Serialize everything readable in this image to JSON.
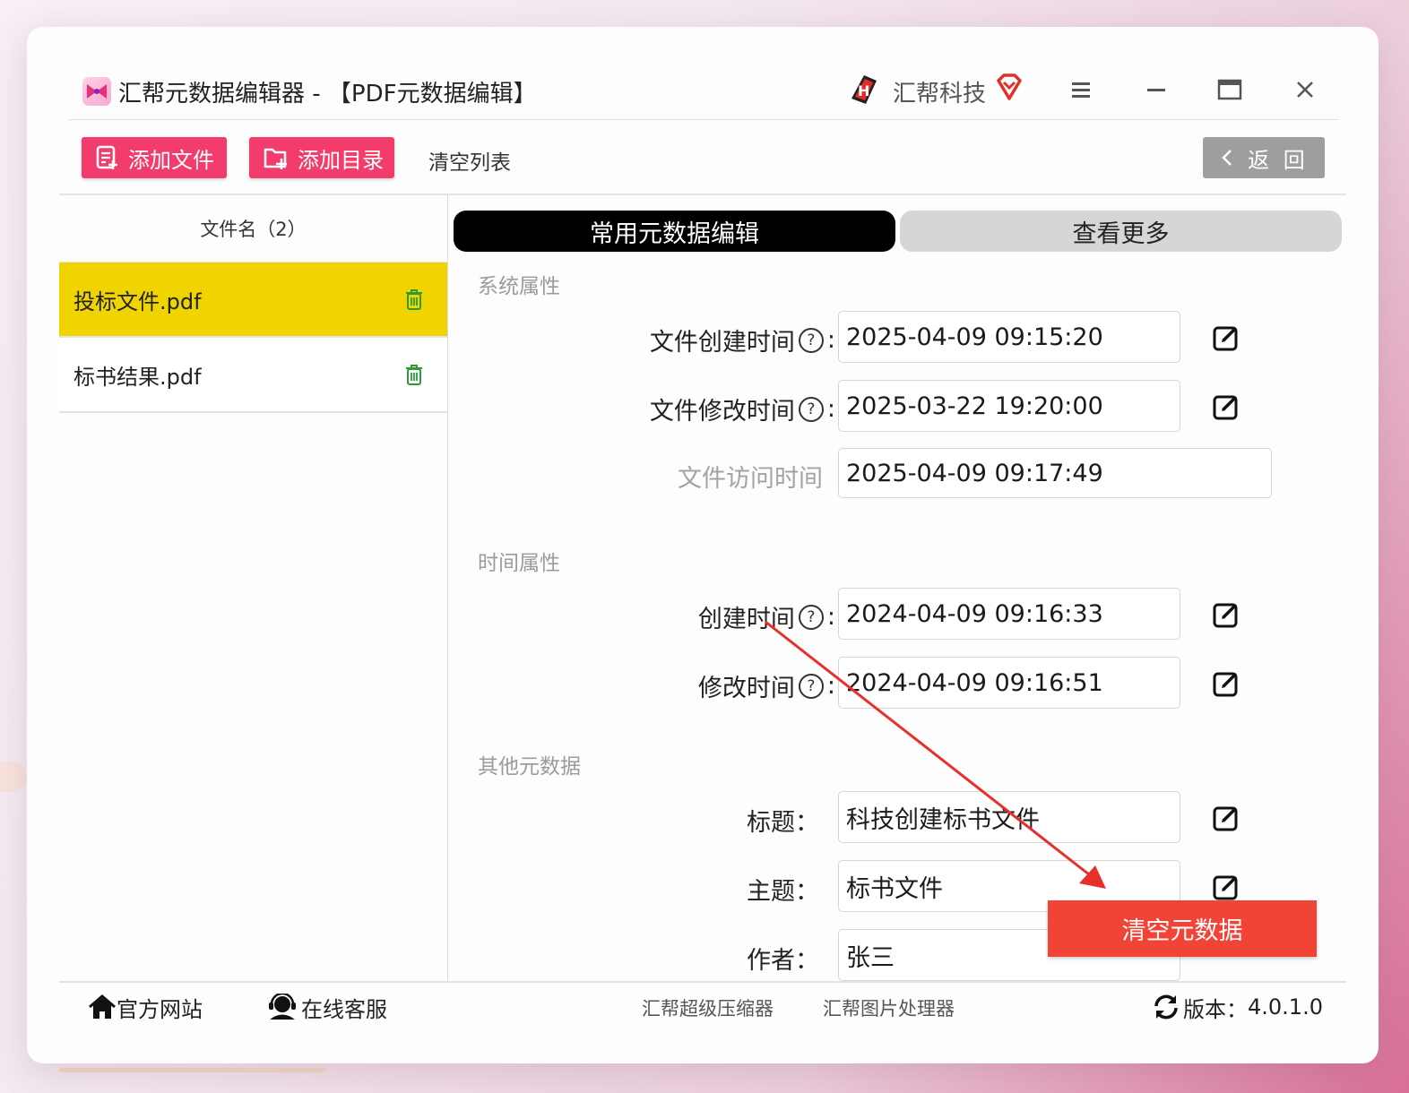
{
  "window": {
    "title": "汇帮元数据编辑器 - 【PDF元数据编辑】",
    "brand": "汇帮科技"
  },
  "toolbar": {
    "add_file": "添加文件",
    "add_dir": "添加目录",
    "clear_list": "清空列表",
    "back": "返 回"
  },
  "file_list": {
    "header": "文件名（2）",
    "items": [
      {
        "name": "投标文件.pdf",
        "selected": true
      },
      {
        "name": "标书结果.pdf",
        "selected": false
      }
    ]
  },
  "tabs": {
    "common": "常用元数据编辑",
    "more": "查看更多"
  },
  "sections": {
    "system": "系统属性",
    "time": "时间属性",
    "other": "其他元数据"
  },
  "fields": {
    "file_created": {
      "label": "文件创建时间",
      "value": "2025-04-09 09:15:20"
    },
    "file_modified": {
      "label": "文件修改时间",
      "value": "2025-03-22 19:20:00"
    },
    "file_accessed": {
      "label": "文件访问时间",
      "value": "2025-04-09 09:17:49"
    },
    "created": {
      "label": "创建时间",
      "value": "2024-04-09 09:16:33"
    },
    "modified": {
      "label": "修改时间",
      "value": "2024-04-09 09:16:51"
    },
    "title": {
      "label": "标题：",
      "value": "科技创建标书文件"
    },
    "subject": {
      "label": "主题：",
      "value": "标书文件"
    },
    "author": {
      "label": "作者：",
      "value": "张三"
    }
  },
  "actions": {
    "clear_metadata": "清空元数据"
  },
  "footer": {
    "website": "官方网站",
    "support": "在线客服",
    "compressor": "汇帮超级压缩器",
    "image_tool": "汇帮图片处理器",
    "version_label": "版本：",
    "version": "4.0.1.0"
  },
  "colors": {
    "accent_pink": "#f33c6c",
    "selected_row": "#f0d400",
    "clear_button": "#f24436",
    "arrow": "#e8302a"
  },
  "icons": [
    "app-logo-icon",
    "brand-logo-icon",
    "heart-icon",
    "menu-icon",
    "minimize-icon",
    "maximize-icon",
    "close-icon",
    "file-add-icon",
    "folder-add-icon",
    "chevron-left-icon",
    "trash-icon",
    "help-icon",
    "edit-icon",
    "home-icon",
    "support-icon",
    "refresh-icon"
  ]
}
